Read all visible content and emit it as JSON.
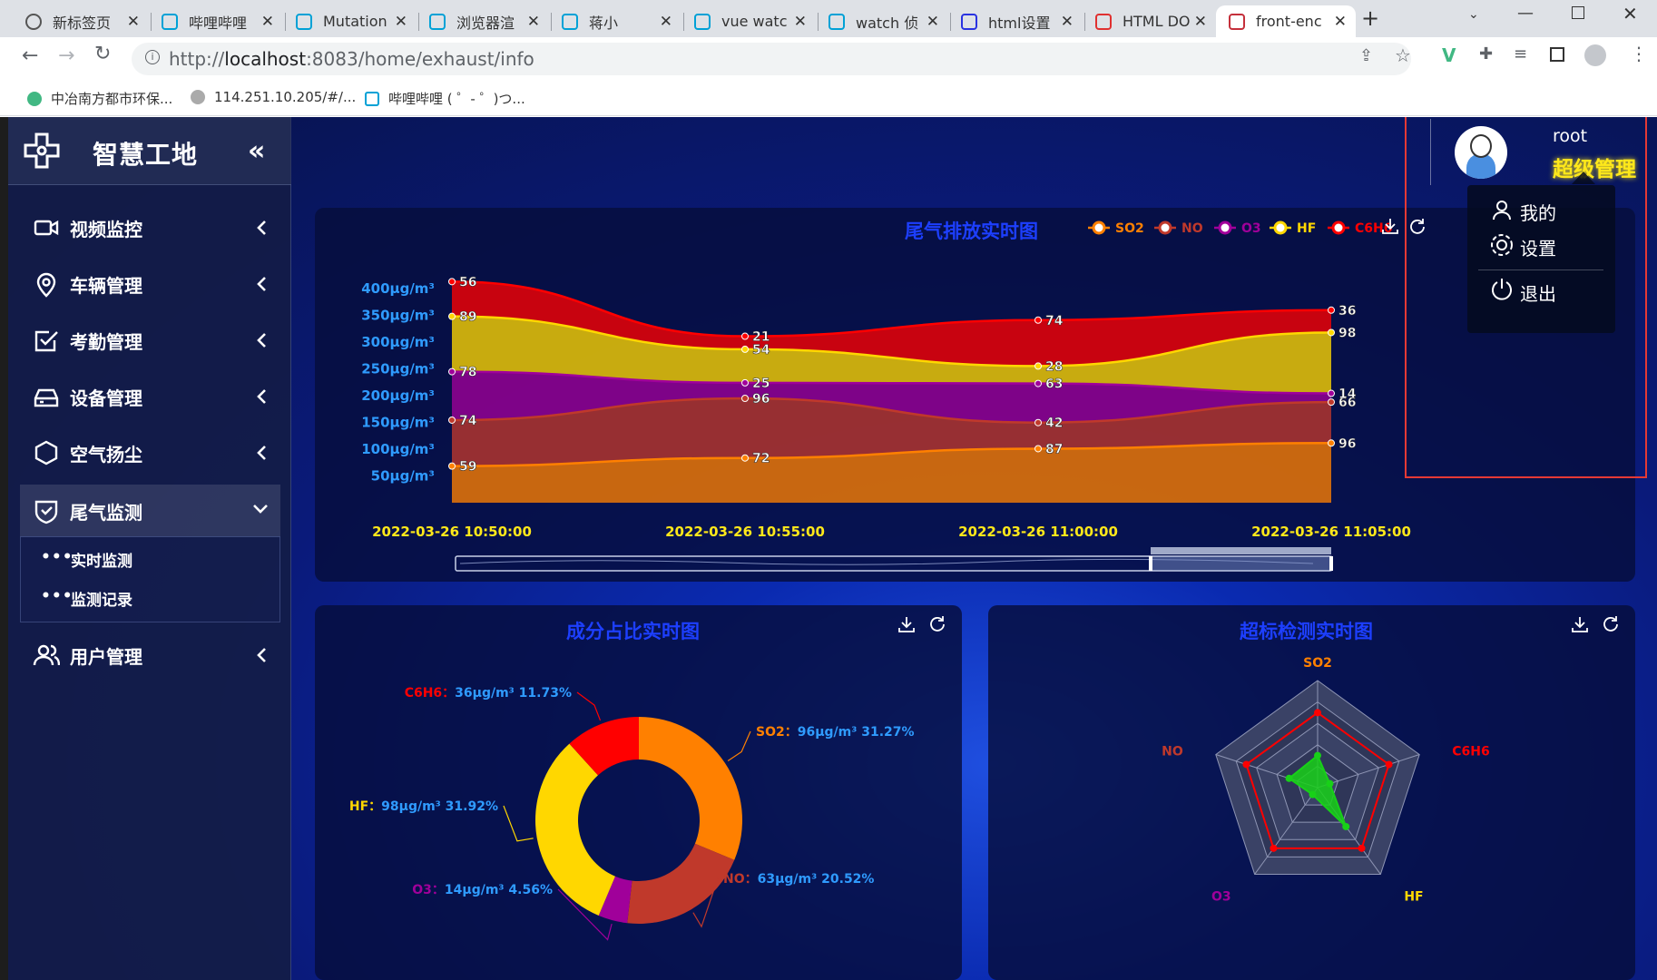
{
  "browser": {
    "tabs": [
      {
        "label": "新标签页",
        "icon": "chrome-icon"
      },
      {
        "label": "哔哩哔哩",
        "icon": "bilibili-icon"
      },
      {
        "label": "Mutation",
        "icon": "bilibili-icon"
      },
      {
        "label": "浏览器渲",
        "icon": "bilibili-icon"
      },
      {
        "label": "蒋小",
        "icon": "bilibili-icon"
      },
      {
        "label": "vue watc",
        "icon": "bilibili-icon"
      },
      {
        "label": "watch 侦",
        "icon": "bilibili-icon"
      },
      {
        "label": "html设置",
        "icon": "baidu-icon"
      },
      {
        "label": "HTML DO",
        "icon": "runoob-icon"
      },
      {
        "label": "front-enc",
        "icon": "page-icon"
      }
    ],
    "url_prefix": "http://",
    "url_host": "localhost",
    "url_rest": ":8083/home/exhaust/info",
    "bookmarks": [
      {
        "label": "中冶南方都市环保..."
      },
      {
        "label": "114.251.10.205/#/..."
      },
      {
        "label": "哔哩哔哩 ( ゜- ゜)つ..."
      }
    ]
  },
  "app": {
    "title": "智慧工地",
    "menu": [
      {
        "label": "视频监控",
        "icon": "video-camera-icon"
      },
      {
        "label": "车辆管理",
        "icon": "location-pin-icon"
      },
      {
        "label": "考勤管理",
        "icon": "checkbox-icon"
      },
      {
        "label": "设备管理",
        "icon": "device-icon"
      },
      {
        "label": "空气扬尘",
        "icon": "hexagon-icon"
      },
      {
        "label": "尾气监测",
        "icon": "shield-check-icon"
      },
      {
        "label": "用户管理",
        "icon": "users-icon"
      }
    ],
    "submenu": [
      "实时监测",
      "监测记录"
    ]
  },
  "user": {
    "name": "root",
    "role": "超级管理",
    "dropdown": [
      "我的",
      "设置",
      "退出"
    ]
  },
  "colors": {
    "so2": "#ff8000",
    "no": "#c0392b",
    "o3": "#a0009a",
    "hf": "#ffd700",
    "c6h6": "#ff0000",
    "accent": "#1d3fff"
  },
  "line_chart": {
    "title": "尾气排放实时图",
    "legend": [
      "SO2",
      "NO",
      "O3",
      "HF",
      "C6H6"
    ],
    "y_labels": [
      "400μg/m³",
      "350μg/m³",
      "300μg/m³",
      "250μg/m³",
      "200μg/m³",
      "150μg/m³",
      "100μg/m³",
      "50μg/m³"
    ],
    "x_labels": [
      "2022-03-26 10:50:00",
      "2022-03-26 10:55:00",
      "2022-03-26 11:00:00",
      "2022-03-26 11:05:00"
    ]
  },
  "pie_chart": {
    "title": "成分占比实时图",
    "labels": [
      {
        "name": "SO2",
        "text": "96μg/m³ 31.27%"
      },
      {
        "name": "NO",
        "text": "63μg/m³ 20.52%"
      },
      {
        "name": "O3",
        "text": "14μg/m³ 4.56%"
      },
      {
        "name": "HF",
        "text": "98μg/m³ 31.92%"
      },
      {
        "name": "C6H6",
        "text": "36μg/m³ 11.73%"
      }
    ]
  },
  "radar_chart": {
    "title": "超标检测实时图",
    "indicators": [
      "SO2",
      "C6H6",
      "HF",
      "O3",
      "NO"
    ]
  },
  "chart_data": [
    {
      "type": "area",
      "title": "尾气排放实时图",
      "x": [
        "2022-03-26 10:50:00",
        "2022-03-26 10:55:00",
        "2022-03-26 11:00:00",
        "2022-03-26 11:05:00"
      ],
      "stacked": true,
      "y_ticks": [
        "50μg/m³",
        "100μg/m³",
        "150μg/m³",
        "200μg/m³",
        "250μg/m³",
        "300μg/m³",
        "350μg/m³",
        "400μg/m³"
      ],
      "series": [
        {
          "name": "SO2",
          "values": [
            59,
            72,
            87,
            96
          ]
        },
        {
          "name": "NO",
          "values": [
            74,
            96,
            42,
            66
          ]
        },
        {
          "name": "O3",
          "values": [
            78,
            25,
            63,
            14
          ]
        },
        {
          "name": "HF",
          "values": [
            89,
            54,
            28,
            98
          ]
        },
        {
          "name": "C6H6",
          "values": [
            56,
            21,
            74,
            36
          ]
        }
      ],
      "legend": "top-right"
    },
    {
      "type": "pie",
      "title": "成分占比实时图",
      "slices": [
        {
          "name": "SO2",
          "value": 96,
          "percent": 31.27
        },
        {
          "name": "NO",
          "value": 63,
          "percent": 20.52
        },
        {
          "name": "O3",
          "value": 14,
          "percent": 4.56
        },
        {
          "name": "HF",
          "value": 98,
          "percent": 31.92
        },
        {
          "name": "C6H6",
          "value": 36,
          "percent": 11.73
        }
      ]
    },
    {
      "type": "radar",
      "title": "超标检测实时图",
      "indicators": [
        "SO2",
        "C6H6",
        "HF",
        "O3",
        "NO"
      ],
      "series": [
        {
          "name": "limit",
          "values": [
            0.7,
            0.7,
            0.7,
            0.7,
            0.7
          ]
        },
        {
          "name": "current",
          "values": [
            0.3,
            0.12,
            0.45,
            0.08,
            0.28
          ]
        }
      ]
    }
  ]
}
